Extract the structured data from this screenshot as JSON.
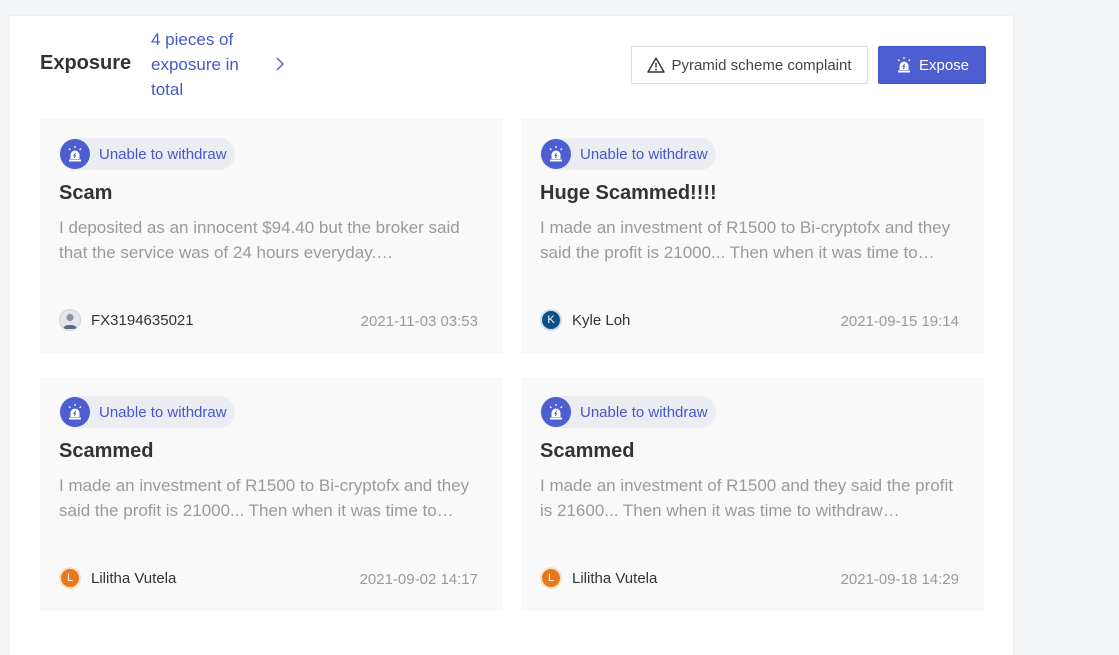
{
  "header": {
    "title": "Exposure",
    "count_text": "4 pieces of exposure in total",
    "complaint_label": "Pyramid scheme complaint",
    "expose_label": "Expose"
  },
  "colors": {
    "accent": "#4d5ed0",
    "link": "#4458cc",
    "card_bg": "#f9f9fa",
    "badge_bg": "#ececf3"
  },
  "cards": [
    {
      "badge": "Unable to withdraw",
      "title": "Scam",
      "description": "I deposited as an innocent $94.40 but the broker said that the service was of 24 hours everyday.…",
      "author": "FX3194635021",
      "avatar_type": "user-photo-icon",
      "avatar_letter": "",
      "date": "2021-11-03 03:53"
    },
    {
      "badge": "Unable to withdraw",
      "title": "Huge Scammed!!!!",
      "description": "I made an investment of R1500 to Bi-cryptofx and they said the profit is 21000... Then when it was time to…",
      "author": "Kyle Loh",
      "avatar_type": "letter-avatar",
      "avatar_letter": "K",
      "date": "2021-09-15 19:14"
    },
    {
      "badge": "Unable to withdraw",
      "title": "Scammed",
      "description": "I made an investment of R1500 to Bi-cryptofx and they said the profit is 21000... Then when it was time to…",
      "author": "Lilitha Vutela",
      "avatar_type": "letter-avatar",
      "avatar_letter": "L",
      "date": "2021-09-02 14:17"
    },
    {
      "badge": "Unable to withdraw",
      "title": "Scammed",
      "description": "I made an investment of R1500 and they said the profit is 21600... Then when it was time to withdraw…",
      "author": "Lilitha Vutela",
      "avatar_type": "letter-avatar",
      "avatar_letter": "L",
      "date": "2021-09-18 14:29"
    }
  ]
}
